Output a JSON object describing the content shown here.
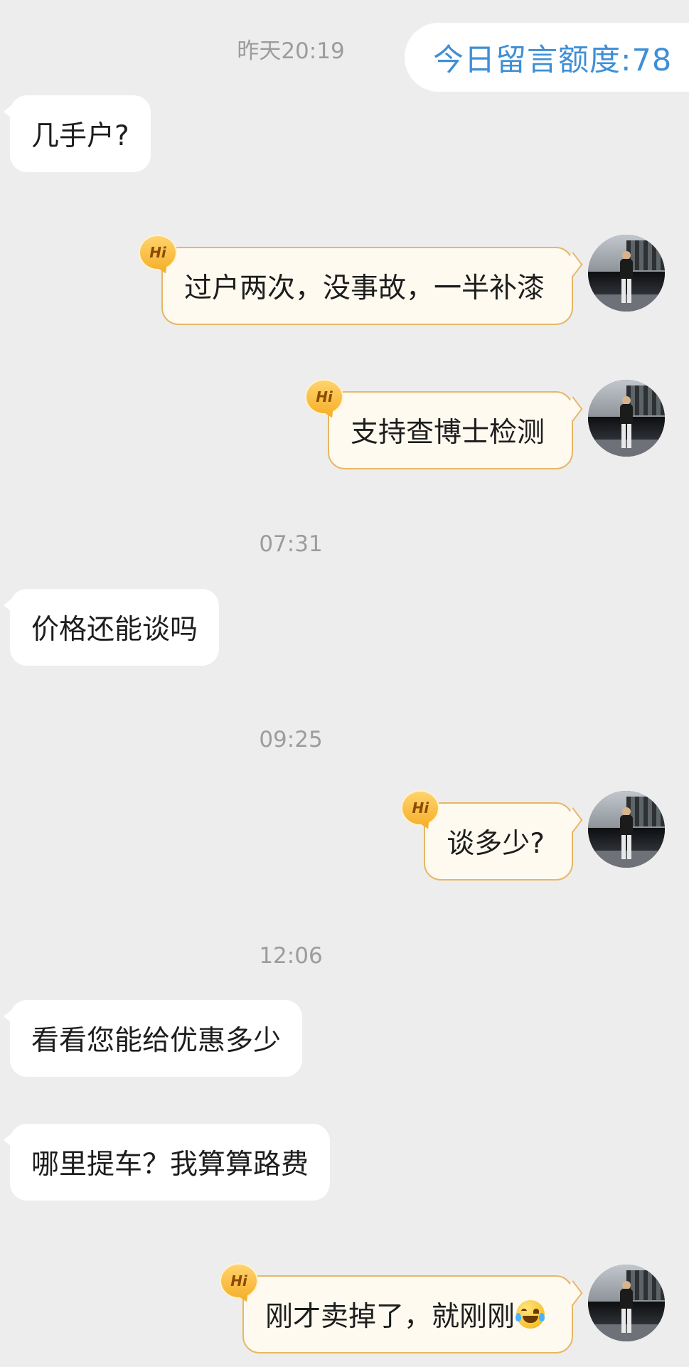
{
  "header": {
    "quota_label": "今日留言额度:78"
  },
  "messages": [
    {
      "type": "timestamp",
      "text": "昨天20:19"
    },
    {
      "type": "received",
      "text": "几手户?"
    },
    {
      "type": "sent",
      "text": "过户两次，没事故，一半补漆",
      "badge": "Hi"
    },
    {
      "type": "sent",
      "text": "支持查博士检测",
      "badge": "Hi"
    },
    {
      "type": "timestamp",
      "text": "07:31"
    },
    {
      "type": "received",
      "text": "价格还能谈吗"
    },
    {
      "type": "timestamp",
      "text": "09:25"
    },
    {
      "type": "sent",
      "text": "谈多少?",
      "badge": "Hi"
    },
    {
      "type": "timestamp",
      "text": "12:06"
    },
    {
      "type": "received",
      "text": "看看您能给优惠多少"
    },
    {
      "type": "received",
      "text": "哪里提车？我算算路费"
    },
    {
      "type": "sent",
      "text": "刚才卖掉了，就刚刚",
      "badge": "Hi",
      "trailing_icon": "laughing-crying-emoji"
    }
  ]
}
